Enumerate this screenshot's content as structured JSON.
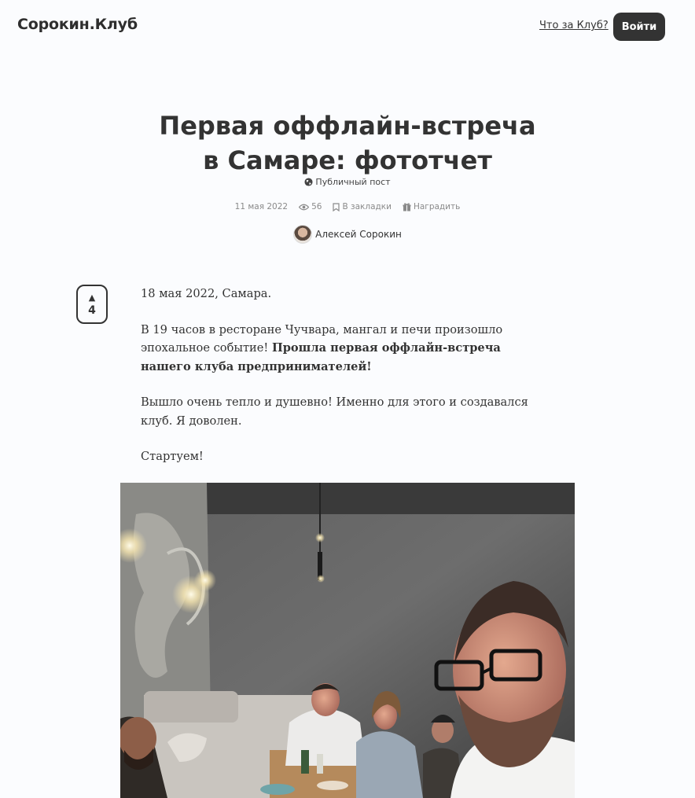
{
  "header": {
    "logo": "Сорокин.Клуб",
    "about_link": "Что за Клуб?",
    "login_button": "Войти"
  },
  "post": {
    "title_line1": "Первая оффлайн-встреча",
    "title_line2": "в Самаре: фототчет",
    "visibility": "Публичный пост",
    "date": "11 мая 2022",
    "views": "56",
    "bookmark_label": "В закладки",
    "reward_label": "Наградить",
    "author": "Алексей Сорокин",
    "upvotes": "4",
    "paragraphs": {
      "p1": "18 мая 2022, Самара.",
      "p2_plain": "В 19 часов в ресторане Чучвара, мангал и печи произошло эпохальное событие! ",
      "p2_bold": "Прошла первая оффлайн-встреча нашего клуба предпринимателей!",
      "p3": "Вышло очень тепло и душевно! Именно для этого и создавался клуб. Я доволен.",
      "p4": "Стартуем!"
    }
  },
  "colors": {
    "background": "#fbfcfe",
    "text": "#333333",
    "muted": "#8a8a8a",
    "button": "#333333"
  },
  "icons": {
    "visibility": "globe-icon",
    "views": "eye-icon",
    "bookmark": "bookmark-icon",
    "reward": "gift-icon",
    "upvote": "triangle-up-icon"
  }
}
